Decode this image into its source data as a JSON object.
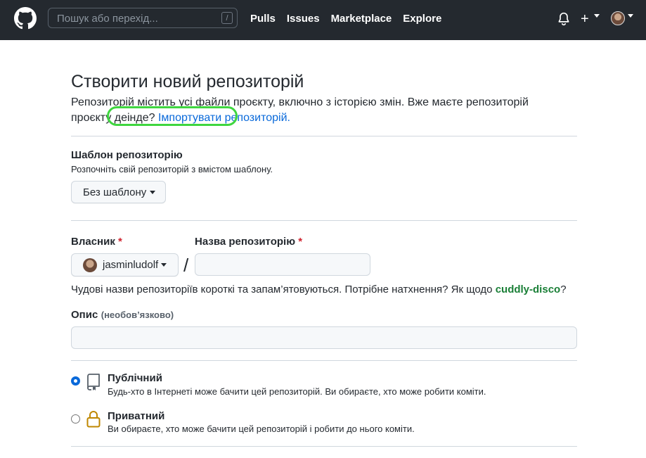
{
  "header": {
    "search_placeholder": "Пошук або перехід...",
    "search_shortcut": "/",
    "nav": [
      "Pulls",
      "Issues",
      "Marketplace",
      "Explore"
    ]
  },
  "page": {
    "title": "Створити новий репозиторій",
    "intro_text": "Репозиторій містить усі файли проєкту, включно з історією змін. Вже маєте репозиторій проєкту деінде?",
    "import_link": "Імпортувати репозиторій."
  },
  "template": {
    "label": "Шаблон репозиторію",
    "hint": "Розпочніть свій репозиторій з вмістом шаблону.",
    "button": "Без шаблону"
  },
  "owner": {
    "label": "Власник",
    "required_mark": "*",
    "value": "jasminludolf"
  },
  "repo_name": {
    "label": "Назва репозиторію",
    "required_mark": "*",
    "value": "",
    "separator": "/"
  },
  "name_hint": {
    "text": "Чудові назви репозиторіїв короткі та запам’ятовуються. Потрібне натхнення? Як щодо",
    "suggestion": "cuddly-disco",
    "end": "?"
  },
  "description": {
    "label": "Опис",
    "optional": "(необов’язково)",
    "value": ""
  },
  "visibility": [
    {
      "title": "Публічний",
      "desc": "Будь-хто в Інтернеті може бачити цей репозиторій. Ви обираєте, хто може робити коміти.",
      "selected": true,
      "icon": "repo-icon"
    },
    {
      "title": "Приватний",
      "desc": "Ви обираєте, хто може бачити цей репозиторій і робити до нього коміти.",
      "selected": false,
      "icon": "lock-icon"
    }
  ],
  "colors": {
    "header_bg": "#24292f",
    "link": "#0969da",
    "highlight": "#3fd63f",
    "suggestion": "#1a7f37",
    "required": "#cf222e"
  }
}
